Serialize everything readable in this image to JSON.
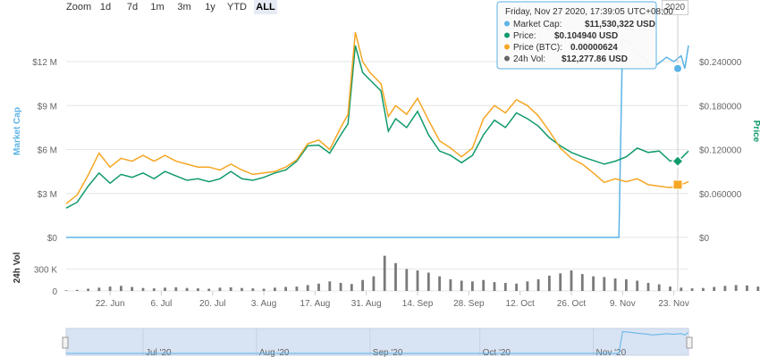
{
  "zoom": {
    "label": "Zoom",
    "buttons": [
      "1d",
      "7d",
      "1m",
      "3m",
      "1y",
      "YTD",
      "ALL"
    ],
    "active": "ALL"
  },
  "range_input_fragment": "2020",
  "tooltip": {
    "header": "Friday, Nov 27 2020, 17:39:05 UTC+08:00",
    "rows": [
      {
        "label": "Market Cap:",
        "value": "$11,530,322 USD",
        "color": "#5bb3e6"
      },
      {
        "label": "Price:",
        "value": "$0.104940 USD",
        "color": "#109a6b"
      },
      {
        "label": "Price (BTC):",
        "value": "0.00000624",
        "color": "#f5a623"
      },
      {
        "label": "24h Vol:",
        "value": "$12,277.86 USD",
        "color": "#666666"
      }
    ]
  },
  "colors": {
    "market_cap": "#5bb3e6",
    "price": "#109a6b",
    "price_btc": "#f5a623",
    "volume": "#7a7a7a",
    "navigator_fill": "#d8e3f3",
    "grid": "#e6e6e6"
  },
  "chart_data": [
    {
      "type": "line",
      "ylabel_left": "Market Cap",
      "ylabel_right": "Price",
      "left_ticks": [
        "$0",
        "$3 M",
        "$6 M",
        "$9 M",
        "$12 M"
      ],
      "left_tick_values": [
        0,
        3000000,
        6000000,
        9000000,
        12000000
      ],
      "right_ticks": [
        "$0",
        "$0.060000",
        "$0.120000",
        "$0.180000",
        "$0.240000"
      ],
      "right_tick_values": [
        0,
        0.06,
        0.12,
        0.18,
        0.24
      ],
      "ylim_left": [
        0,
        14500000
      ],
      "ylim_right": [
        0,
        0.29
      ],
      "xlim": [
        "2020-06-10",
        "2020-11-27"
      ],
      "x_ticks": [
        "22. Jun",
        "6. Jul",
        "20. Jul",
        "3. Aug",
        "17. Aug",
        "31. Aug",
        "14. Sep",
        "28. Sep",
        "12. Oct",
        "26. Oct",
        "9. Nov",
        "23. Nov"
      ],
      "x_tick_dates": [
        "2020-06-22",
        "2020-07-06",
        "2020-07-20",
        "2020-08-03",
        "2020-08-17",
        "2020-08-31",
        "2020-09-14",
        "2020-09-28",
        "2020-10-12",
        "2020-10-26",
        "2020-11-09",
        "2020-11-23"
      ],
      "grid": true,
      "series": [
        {
          "name": "Market Cap",
          "axis": "left",
          "points": [
            [
              "2020-06-10",
              0
            ],
            [
              "2020-11-08",
              0
            ],
            [
              "2020-11-09",
              13600000
            ],
            [
              "2020-11-11",
              13300000
            ],
            [
              "2020-11-13",
              12600000
            ],
            [
              "2020-11-15",
              12200000
            ],
            [
              "2020-11-17",
              11600000
            ],
            [
              "2020-11-19",
              11900000
            ],
            [
              "2020-11-21",
              12300000
            ],
            [
              "2020-11-23",
              12000000
            ],
            [
              "2020-11-25",
              12400000
            ],
            [
              "2020-11-26",
              11530000
            ],
            [
              "2020-11-27",
              13100000
            ]
          ]
        },
        {
          "name": "Price",
          "axis": "right",
          "points": [
            [
              "2020-06-10",
              0.04
            ],
            [
              "2020-06-13",
              0.048
            ],
            [
              "2020-06-16",
              0.07
            ],
            [
              "2020-06-19",
              0.088
            ],
            [
              "2020-06-22",
              0.074
            ],
            [
              "2020-06-25",
              0.086
            ],
            [
              "2020-06-28",
              0.082
            ],
            [
              "2020-07-01",
              0.088
            ],
            [
              "2020-07-04",
              0.08
            ],
            [
              "2020-07-07",
              0.09
            ],
            [
              "2020-07-10",
              0.084
            ],
            [
              "2020-07-13",
              0.078
            ],
            [
              "2020-07-16",
              0.08
            ],
            [
              "2020-07-19",
              0.076
            ],
            [
              "2020-07-22",
              0.08
            ],
            [
              "2020-07-25",
              0.09
            ],
            [
              "2020-07-28",
              0.08
            ],
            [
              "2020-07-31",
              0.078
            ],
            [
              "2020-08-03",
              0.082
            ],
            [
              "2020-08-06",
              0.088
            ],
            [
              "2020-08-09",
              0.092
            ],
            [
              "2020-08-12",
              0.104
            ],
            [
              "2020-08-15",
              0.125
            ],
            [
              "2020-08-18",
              0.126
            ],
            [
              "2020-08-21",
              0.115
            ],
            [
              "2020-08-24",
              0.14
            ],
            [
              "2020-08-26",
              0.155
            ],
            [
              "2020-08-28",
              0.262
            ],
            [
              "2020-08-30",
              0.225
            ],
            [
              "2020-09-01",
              0.215
            ],
            [
              "2020-09-04",
              0.2
            ],
            [
              "2020-09-06",
              0.145
            ],
            [
              "2020-09-08",
              0.162
            ],
            [
              "2020-09-11",
              0.15
            ],
            [
              "2020-09-14",
              0.172
            ],
            [
              "2020-09-17",
              0.14
            ],
            [
              "2020-09-20",
              0.118
            ],
            [
              "2020-09-23",
              0.112
            ],
            [
              "2020-09-26",
              0.102
            ],
            [
              "2020-09-29",
              0.112
            ],
            [
              "2020-10-02",
              0.14
            ],
            [
              "2020-10-05",
              0.16
            ],
            [
              "2020-10-08",
              0.15
            ],
            [
              "2020-10-11",
              0.17
            ],
            [
              "2020-10-14",
              0.162
            ],
            [
              "2020-10-17",
              0.152
            ],
            [
              "2020-10-20",
              0.136
            ],
            [
              "2020-10-23",
              0.125
            ],
            [
              "2020-10-26",
              0.116
            ],
            [
              "2020-10-29",
              0.11
            ],
            [
              "2020-11-01",
              0.105
            ],
            [
              "2020-11-04",
              0.1
            ],
            [
              "2020-11-07",
              0.104
            ],
            [
              "2020-11-10",
              0.11
            ],
            [
              "2020-11-13",
              0.122
            ],
            [
              "2020-11-16",
              0.116
            ],
            [
              "2020-11-19",
              0.118
            ],
            [
              "2020-11-22",
              0.104
            ],
            [
              "2020-11-25",
              0.108
            ],
            [
              "2020-11-27",
              0.118
            ]
          ]
        },
        {
          "name": "Price (BTC)",
          "axis": "right",
          "points": [
            [
              "2020-06-10",
              0.046
            ],
            [
              "2020-06-13",
              0.058
            ],
            [
              "2020-06-16",
              0.085
            ],
            [
              "2020-06-19",
              0.115
            ],
            [
              "2020-06-22",
              0.096
            ],
            [
              "2020-06-25",
              0.108
            ],
            [
              "2020-06-28",
              0.104
            ],
            [
              "2020-07-01",
              0.112
            ],
            [
              "2020-07-04",
              0.104
            ],
            [
              "2020-07-07",
              0.112
            ],
            [
              "2020-07-10",
              0.104
            ],
            [
              "2020-07-13",
              0.1
            ],
            [
              "2020-07-16",
              0.096
            ],
            [
              "2020-07-19",
              0.096
            ],
            [
              "2020-07-22",
              0.092
            ],
            [
              "2020-07-25",
              0.1
            ],
            [
              "2020-07-28",
              0.092
            ],
            [
              "2020-07-31",
              0.086
            ],
            [
              "2020-08-03",
              0.088
            ],
            [
              "2020-08-06",
              0.09
            ],
            [
              "2020-08-09",
              0.096
            ],
            [
              "2020-08-12",
              0.106
            ],
            [
              "2020-08-15",
              0.128
            ],
            [
              "2020-08-18",
              0.133
            ],
            [
              "2020-08-21",
              0.12
            ],
            [
              "2020-08-24",
              0.15
            ],
            [
              "2020-08-26",
              0.168
            ],
            [
              "2020-08-28",
              0.28
            ],
            [
              "2020-08-30",
              0.24
            ],
            [
              "2020-09-01",
              0.225
            ],
            [
              "2020-09-04",
              0.21
            ],
            [
              "2020-09-06",
              0.165
            ],
            [
              "2020-09-08",
              0.18
            ],
            [
              "2020-09-11",
              0.168
            ],
            [
              "2020-09-14",
              0.19
            ],
            [
              "2020-09-17",
              0.16
            ],
            [
              "2020-09-20",
              0.132
            ],
            [
              "2020-09-23",
              0.122
            ],
            [
              "2020-09-26",
              0.11
            ],
            [
              "2020-09-29",
              0.122
            ],
            [
              "2020-10-02",
              0.162
            ],
            [
              "2020-10-05",
              0.18
            ],
            [
              "2020-10-08",
              0.17
            ],
            [
              "2020-10-11",
              0.188
            ],
            [
              "2020-10-14",
              0.18
            ],
            [
              "2020-10-17",
              0.166
            ],
            [
              "2020-10-20",
              0.145
            ],
            [
              "2020-10-23",
              0.122
            ],
            [
              "2020-10-26",
              0.108
            ],
            [
              "2020-10-29",
              0.1
            ],
            [
              "2020-11-01",
              0.088
            ],
            [
              "2020-11-04",
              0.075
            ],
            [
              "2020-11-07",
              0.08
            ],
            [
              "2020-11-10",
              0.076
            ],
            [
              "2020-11-13",
              0.08
            ],
            [
              "2020-11-16",
              0.072
            ],
            [
              "2020-11-19",
              0.07
            ],
            [
              "2020-11-22",
              0.068
            ],
            [
              "2020-11-25",
              0.072
            ],
            [
              "2020-11-27",
              0.076
            ]
          ]
        }
      ]
    },
    {
      "type": "bar",
      "ylabel": "24h Vol",
      "y_ticks": [
        "0",
        "300 K"
      ],
      "y_tick_values": [
        0,
        300000
      ],
      "ylim": [
        0,
        560000
      ],
      "start_date": "2020-06-10",
      "interval_days": 3,
      "values": [
        8000,
        15000,
        30000,
        45000,
        60000,
        70000,
        55000,
        40000,
        35000,
        45000,
        50000,
        40000,
        35000,
        30000,
        45000,
        50000,
        40000,
        35000,
        30000,
        45000,
        55000,
        60000,
        80000,
        100000,
        130000,
        110000,
        95000,
        150000,
        200000,
        480000,
        380000,
        300000,
        280000,
        250000,
        200000,
        160000,
        140000,
        130000,
        150000,
        120000,
        110000,
        100000,
        130000,
        160000,
        210000,
        240000,
        280000,
        230000,
        200000,
        190000,
        170000,
        160000,
        140000,
        110000,
        90000,
        60000,
        45000,
        35000,
        40000,
        55000,
        70000,
        80000,
        75000,
        60000,
        35000
      ]
    },
    {
      "type": "line",
      "role": "navigator",
      "x_ticks": [
        "Jul '20",
        "Aug '20",
        "Sep '20",
        "Oct '20",
        "Nov '20"
      ]
    }
  ]
}
